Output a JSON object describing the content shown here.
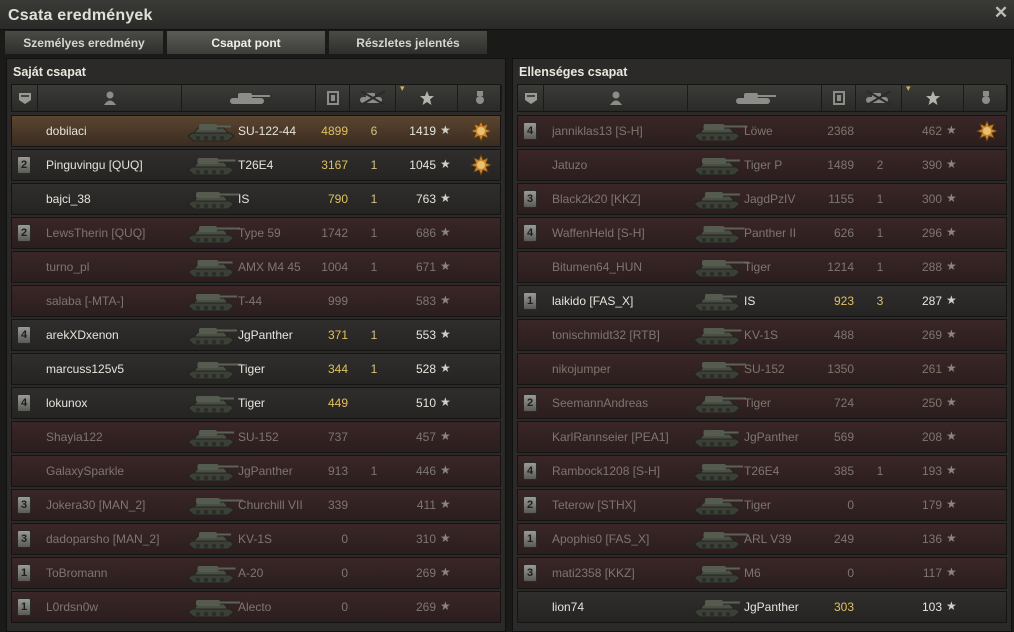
{
  "window": {
    "title": "Csata eredmények"
  },
  "tabs": [
    {
      "label": "Személyes eredmény"
    },
    {
      "label": "Csapat pont"
    },
    {
      "label": "Részletes jelentés"
    }
  ],
  "teams": [
    {
      "title": "Saját csapat",
      "rows": [
        {
          "player": "dobilaci",
          "vehicle": "SU-122-44",
          "damage": "4899",
          "kills": "6",
          "xp": "1419",
          "squad": "",
          "medal": true,
          "state": "me"
        },
        {
          "player": "Pinguvingu [QUQ]",
          "vehicle": "T26E4",
          "damage": "3167",
          "kills": "1",
          "xp": "1045",
          "squad": "2",
          "medal": true,
          "state": "alive"
        },
        {
          "player": "bajci_38",
          "vehicle": "IS",
          "damage": "790",
          "kills": "1",
          "xp": "763",
          "squad": "",
          "medal": false,
          "state": "alive"
        },
        {
          "player": "LewsTherin [QUQ]",
          "vehicle": "Type 59",
          "damage": "1742",
          "kills": "1",
          "xp": "686",
          "squad": "2",
          "medal": false,
          "state": "dead"
        },
        {
          "player": "turno_pl",
          "vehicle": "AMX M4 45",
          "damage": "1004",
          "kills": "1",
          "xp": "671",
          "squad": "",
          "medal": false,
          "state": "dead"
        },
        {
          "player": "salaba [-MTA-]",
          "vehicle": "T-44",
          "damage": "999",
          "kills": "",
          "xp": "583",
          "squad": "",
          "medal": false,
          "state": "dead"
        },
        {
          "player": "arekXDxenon",
          "vehicle": "JgPanther",
          "damage": "371",
          "kills": "1",
          "xp": "553",
          "squad": "4",
          "medal": false,
          "state": "alive"
        },
        {
          "player": "marcuss125v5",
          "vehicle": "Tiger",
          "damage": "344",
          "kills": "1",
          "xp": "528",
          "squad": "",
          "medal": false,
          "state": "alive"
        },
        {
          "player": "lokunox",
          "vehicle": "Tiger",
          "damage": "449",
          "kills": "",
          "xp": "510",
          "squad": "4",
          "medal": false,
          "state": "alive"
        },
        {
          "player": "Shayia122",
          "vehicle": "SU-152",
          "damage": "737",
          "kills": "",
          "xp": "457",
          "squad": "",
          "medal": false,
          "state": "dead"
        },
        {
          "player": "GalaxySparkle",
          "vehicle": "JgPanther",
          "damage": "913",
          "kills": "1",
          "xp": "446",
          "squad": "",
          "medal": false,
          "state": "dead"
        },
        {
          "player": "Jokera30 [MAN_2]",
          "vehicle": "Churchill VII",
          "damage": "339",
          "kills": "",
          "xp": "411",
          "squad": "3",
          "medal": false,
          "state": "dead"
        },
        {
          "player": "dadoparsho [MAN_2]",
          "vehicle": "KV-1S",
          "damage": "0",
          "kills": "",
          "xp": "310",
          "squad": "3",
          "medal": false,
          "state": "dead"
        },
        {
          "player": "ToBromann",
          "vehicle": "A-20",
          "damage": "0",
          "kills": "",
          "xp": "269",
          "squad": "1",
          "medal": false,
          "state": "dead"
        },
        {
          "player": "L0rdsn0w",
          "vehicle": "Alecto",
          "damage": "0",
          "kills": "",
          "xp": "269",
          "squad": "1",
          "medal": false,
          "state": "dead"
        }
      ]
    },
    {
      "title": "Ellenséges csapat",
      "rows": [
        {
          "player": "janniklas13 [S-H]",
          "vehicle": "Löwe",
          "damage": "2368",
          "kills": "",
          "xp": "462",
          "squad": "4",
          "medal": true,
          "state": "dead"
        },
        {
          "player": "Jatuzo",
          "vehicle": "Tiger P",
          "damage": "1489",
          "kills": "2",
          "xp": "390",
          "squad": "",
          "medal": false,
          "state": "dead"
        },
        {
          "player": "Black2k20 [KKZ]",
          "vehicle": "JagdPzIV",
          "damage": "1155",
          "kills": "1",
          "xp": "300",
          "squad": "3",
          "medal": false,
          "state": "dead"
        },
        {
          "player": "WaffenHeld [S-H]",
          "vehicle": "Panther II",
          "damage": "626",
          "kills": "1",
          "xp": "296",
          "squad": "4",
          "medal": false,
          "state": "dead"
        },
        {
          "player": "Bitumen64_HUN",
          "vehicle": "Tiger",
          "damage": "1214",
          "kills": "1",
          "xp": "288",
          "squad": "",
          "medal": false,
          "state": "dead"
        },
        {
          "player": "laikido [FAS_X]",
          "vehicle": "IS",
          "damage": "923",
          "kills": "3",
          "xp": "287",
          "squad": "1",
          "medal": false,
          "state": "alive"
        },
        {
          "player": "tonischmidt32 [RTB]",
          "vehicle": "KV-1S",
          "damage": "488",
          "kills": "",
          "xp": "269",
          "squad": "",
          "medal": false,
          "state": "dead"
        },
        {
          "player": "nikojumper",
          "vehicle": "SU-152",
          "damage": "1350",
          "kills": "",
          "xp": "261",
          "squad": "",
          "medal": false,
          "state": "dead"
        },
        {
          "player": "SeemannAndreas",
          "vehicle": "Tiger",
          "damage": "724",
          "kills": "",
          "xp": "250",
          "squad": "2",
          "medal": false,
          "state": "dead"
        },
        {
          "player": "KarlRannseier [PEA1]",
          "vehicle": "JgPanther",
          "damage": "569",
          "kills": "",
          "xp": "208",
          "squad": "",
          "medal": false,
          "state": "dead"
        },
        {
          "player": "Rambock1208 [S-H]",
          "vehicle": "T26E4",
          "damage": "385",
          "kills": "1",
          "xp": "193",
          "squad": "4",
          "medal": false,
          "state": "dead"
        },
        {
          "player": "Teterow [STHX]",
          "vehicle": "Tiger",
          "damage": "0",
          "kills": "",
          "xp": "179",
          "squad": "2",
          "medal": false,
          "state": "dead"
        },
        {
          "player": "Apophis0 [FAS_X]",
          "vehicle": "ARL V39",
          "damage": "249",
          "kills": "",
          "xp": "136",
          "squad": "1",
          "medal": false,
          "state": "dead"
        },
        {
          "player": "mati2358 [KKZ]",
          "vehicle": "M6",
          "damage": "0",
          "kills": "",
          "xp": "117",
          "squad": "3",
          "medal": false,
          "state": "dead"
        },
        {
          "player": "lion74",
          "vehicle": "JgPanther",
          "damage": "303",
          "kills": "",
          "xp": "103",
          "squad": "",
          "medal": false,
          "state": "alive"
        }
      ]
    }
  ],
  "icons": {
    "close": "close-icon",
    "squad": "squad-icon",
    "player": "player-icon",
    "vehicle": "tank-icon",
    "damage": "damage-icon",
    "kills": "kills-icon",
    "xp": "star-icon",
    "medal": "medal-icon"
  },
  "colors": {
    "damage": "#e0c060",
    "dead_row": "#3a2626",
    "me_row": "#5a4530"
  }
}
